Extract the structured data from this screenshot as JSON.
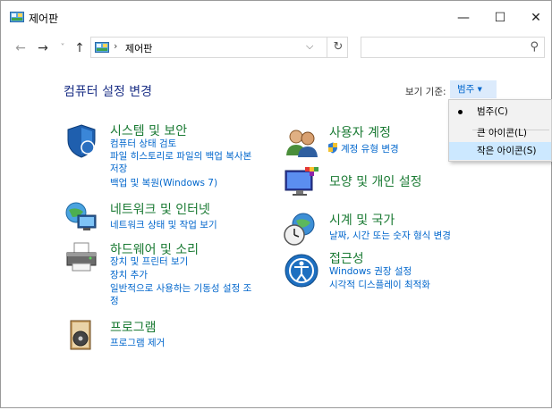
{
  "window": {
    "title": "제어판",
    "controls": {
      "minimize": "—",
      "maximize": "☐",
      "close": "✕"
    }
  },
  "nav": {
    "back": "←",
    "forward": "→",
    "recent": "˅",
    "up": "↑",
    "address_separator": "›",
    "address_text": "제어판",
    "address_dropdown": "⌵",
    "refresh": "↻",
    "search_placeholder": "",
    "search_glyph": "⚲"
  },
  "main": {
    "title": "컴퓨터 설정 변경",
    "view_by_label": "보기 기준:",
    "view_by_value": "범주 ▾"
  },
  "categories": [
    {
      "title": "시스템 및 보안",
      "icon": "shield-icon",
      "links": [
        "컴퓨터 상태 검토",
        "파일 히스토리로 파일의 백업 복사본",
        "저장",
        "백업 및 복원(Windows 7)"
      ]
    },
    {
      "title": "네트워크 및 인터넷",
      "icon": "network-icon",
      "links": [
        "네트워크 상태 및 작업 보기"
      ]
    },
    {
      "title": "하드웨어 및 소리",
      "icon": "printer-icon",
      "links": [
        "장치 및 프린터 보기",
        "장치 추가",
        "일반적으로 사용하는 기동성 설정 조",
        "정"
      ]
    },
    {
      "title": "프로그램",
      "icon": "programs-icon",
      "links": [
        "프로그램 제거"
      ]
    },
    {
      "title": "사용자 계정",
      "icon": "users-icon",
      "links": [
        "계정 유형 변경"
      ]
    },
    {
      "title": "모양 및 개인 설정",
      "icon": "appearance-icon",
      "links": []
    },
    {
      "title": "시계 및 국가",
      "icon": "clock-globe-icon",
      "links": [
        "날짜, 시간 또는 숫자 형식 변경"
      ]
    },
    {
      "title": "접근성",
      "icon": "accessibility-icon",
      "links": [
        "Windows 권장 설정",
        "시각적 디스플레이 최적화"
      ]
    }
  ],
  "menu": {
    "items": [
      "범주(C)",
      "큰 아이콘(L)",
      "작은 아이콘(S)"
    ],
    "checked": "범주(C)",
    "hovered": "작은 아이콘(S)"
  },
  "colors": {
    "link": "#0066cc",
    "category_title": "#1a7a33",
    "heading": "#1e3287",
    "hover": "#cce8ff"
  }
}
